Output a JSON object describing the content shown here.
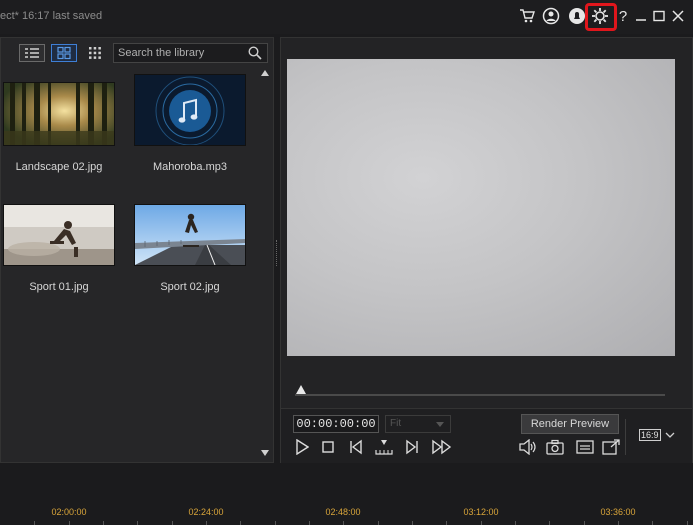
{
  "app": {
    "title": "ect* 16:17 last saved"
  },
  "topbar": {
    "icons": [
      "cart-icon",
      "account-icon",
      "notification-icon",
      "settings-icon",
      "help-icon",
      "minimize-icon",
      "maximize-icon",
      "close-icon"
    ],
    "help_glyph": "?"
  },
  "library": {
    "search_placeholder": "Search the library",
    "items": [
      {
        "name": "Landscape 02.jpg",
        "type": "image"
      },
      {
        "name": "Mahoroba.mp3",
        "type": "audio"
      },
      {
        "name": "Sport 01.jpg",
        "type": "image"
      },
      {
        "name": "Sport 02.jpg",
        "type": "image"
      }
    ]
  },
  "preview": {
    "timecode": "00:00:00:00",
    "fit_label": "Fit",
    "render_label": "Render Preview",
    "aspect_ratio": "16:9"
  },
  "timeline": {
    "ticks": [
      "02:00:00",
      "02:24:00",
      "02:48:00",
      "03:12:00",
      "03:36:00"
    ]
  },
  "colors": {
    "highlight": "#e0161c",
    "accent": "#3e7fd6",
    "timeline_text": "#d9a53a"
  }
}
